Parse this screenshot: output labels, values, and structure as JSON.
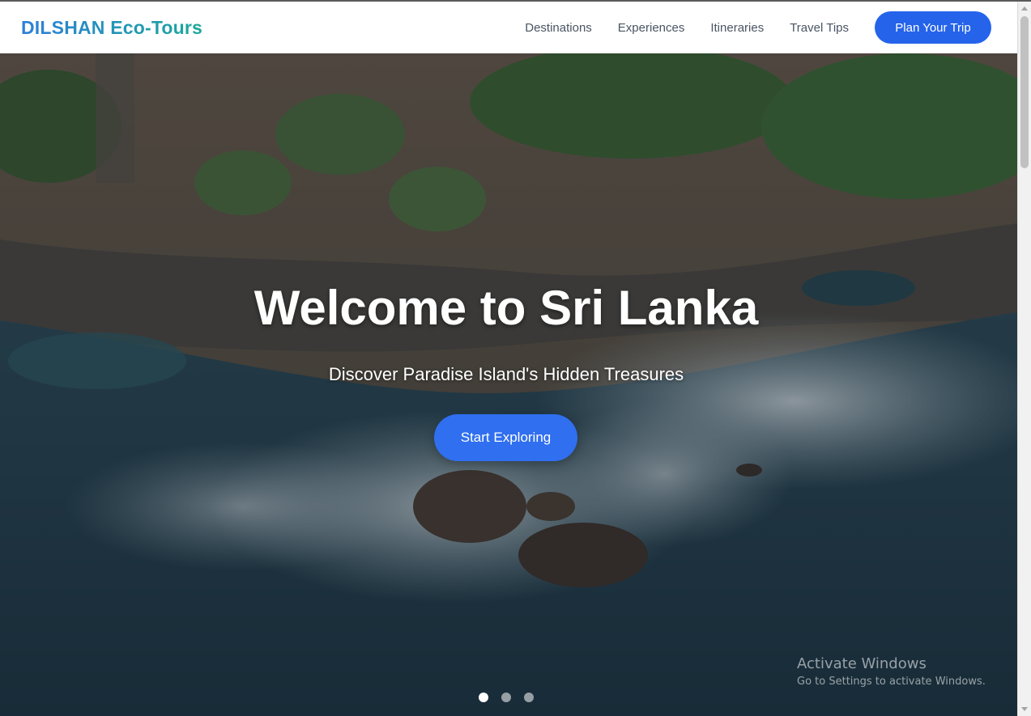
{
  "brand": {
    "name": "DILSHAN Eco-Tours"
  },
  "nav": {
    "items": [
      {
        "label": "Destinations"
      },
      {
        "label": "Experiences"
      },
      {
        "label": "Itineraries"
      },
      {
        "label": "Travel Tips"
      }
    ],
    "cta_label": "Plan Your Trip"
  },
  "hero": {
    "title": "Welcome to Sri Lanka",
    "subtitle": "Discover Paradise Island's Hidden Treasures",
    "cta_label": "Start Exploring",
    "slides": {
      "count": 3,
      "active": 1
    }
  },
  "watermark": {
    "title": "Activate Windows",
    "subtitle": "Go to Settings to activate Windows."
  },
  "colors": {
    "primary": "#2563eb",
    "brand_gradient_start": "#2f7fd9",
    "brand_gradient_end": "#1aa89a",
    "nav_text": "#4a5563"
  }
}
